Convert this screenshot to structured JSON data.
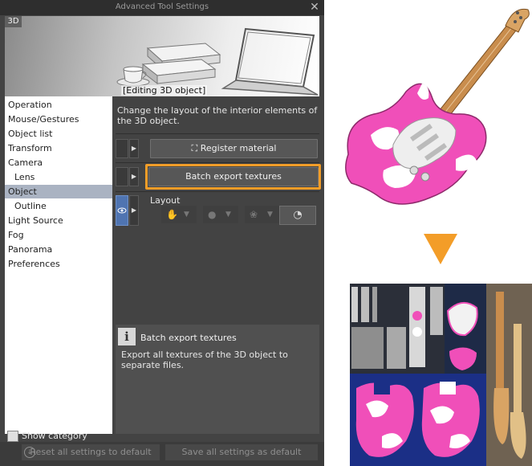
{
  "dialog": {
    "title": "Advanced Tool Settings",
    "close_glyph": "✕",
    "preview": {
      "tag": "3D",
      "editing_label": "[Editing 3D object]"
    },
    "categories": [
      {
        "label": "Operation",
        "indent": false,
        "selected": false
      },
      {
        "label": "Mouse/Gestures",
        "indent": false,
        "selected": false
      },
      {
        "label": "Object list",
        "indent": false,
        "selected": false
      },
      {
        "label": "Transform",
        "indent": false,
        "selected": false
      },
      {
        "label": "Camera",
        "indent": false,
        "selected": false
      },
      {
        "label": "Lens",
        "indent": true,
        "selected": false
      },
      {
        "label": "Object",
        "indent": false,
        "selected": true
      },
      {
        "label": "Outline",
        "indent": true,
        "selected": false
      },
      {
        "label": "Light Source",
        "indent": false,
        "selected": false
      },
      {
        "label": "Fog",
        "indent": false,
        "selected": false
      },
      {
        "label": "Panorama",
        "indent": false,
        "selected": false
      },
      {
        "label": "Preferences",
        "indent": false,
        "selected": false
      }
    ],
    "show_category": "Show category",
    "description": "Change the layout of the interior elements of the 3D object.",
    "commands": {
      "register_material": "Register material",
      "batch_export": "Batch export textures",
      "layout_label": "Layout"
    },
    "info": {
      "title": "Batch export textures",
      "body": "Export all textures of the 3D object to separate files."
    },
    "footer": {
      "reset": "Reset all settings to default",
      "save": "Save all settings as default"
    }
  },
  "colors": {
    "highlight": "#f39d28",
    "selected_category": "#aab3c2",
    "guitar_pink": "#f04fb9",
    "texture_navy": "#232838"
  },
  "icons": {
    "close": "close-icon",
    "info": "info-icon",
    "eye": "eye-icon",
    "register_material": "material-register-icon",
    "arrow_down": "down-arrow-icon"
  }
}
